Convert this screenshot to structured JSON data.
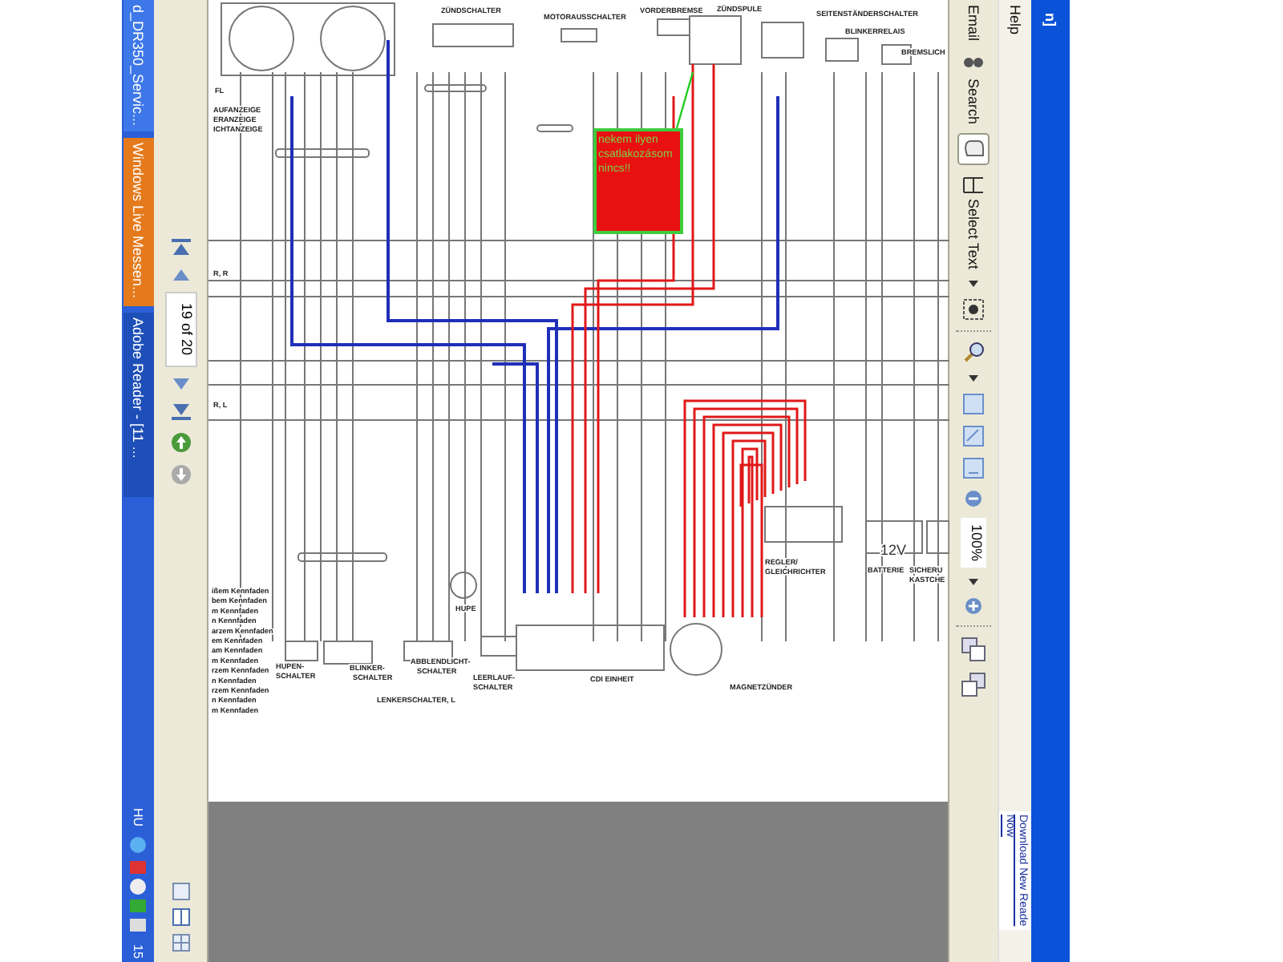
{
  "window": {
    "title": "n]"
  },
  "taskbar": {
    "buttons": [
      {
        "label": "d_DR350_Servic...",
        "selected": false,
        "flashing": false
      },
      {
        "label": "Windows Live Messen...",
        "selected": false,
        "flashing": true
      },
      {
        "label": "Adobe Reader - [11 ...",
        "selected": true,
        "flashing": false
      }
    ],
    "language": "HU",
    "clock": "15"
  },
  "navigation": {
    "page_field": "19 of 20"
  },
  "document": {
    "labels": [
      "ZÜNDSCHALTER",
      "MOTORAUSSCHALTER",
      "VORDERBREMSE",
      "ZÜNDSPULE",
      "SEITENSTÄNDERSCHALTER",
      "BLINKERRELAIS",
      "BREMSLICH",
      "FL",
      "AUFANZEIGE",
      "ERANZEIGE",
      "ICHTANZEIGE",
      "R, R",
      "R, L",
      "12V",
      "REGLER/",
      "GLEICHRICHTER",
      "BATTERIE",
      "SICHERU",
      "KASTCHE",
      "HUPE",
      "HUPEN-",
      "SCHALTER",
      "BLINKER-",
      "SCHALTER",
      "ABBLENDLICHT-",
      "SCHALTER",
      "LENKERSCHALTER, L",
      "LEERLAUF-",
      "SCHALTER",
      "CDI EINHEIT",
      "MAGNETZÜNDER"
    ],
    "legend": [
      "ißem Kennfaden",
      "bem Kennfaden",
      "m Kennfaden",
      "n Kennfaden",
      "arzem Kennfaden",
      "em Kennfaden",
      "am Kennfaden",
      "m Kennfaden",
      "rzem Kennfaden",
      "n Kennfaden",
      "rzem Kennfaden",
      "n Kennfaden",
      "m Kennfaden"
    ],
    "note": "nekem ilyen csatlakozásom nincs!!"
  },
  "toolbar": {
    "email": "Email",
    "search": "Search",
    "hand_selected": true,
    "select_text": "Select Text",
    "zoom": "100%"
  },
  "menu": {
    "help": "Help"
  },
  "update_link": [
    "Download New Reade",
    "Now"
  ]
}
